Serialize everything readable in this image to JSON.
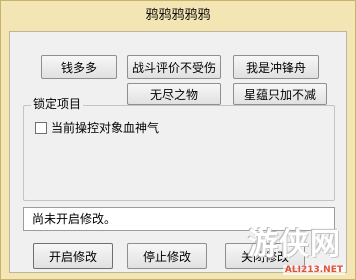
{
  "window": {
    "title": "鸦鸦鸦鸦鸦"
  },
  "buttons": {
    "money": "钱多多",
    "battle": "战斗评价不受伤",
    "charge": "我是冲锋舟",
    "endless": "无尽之物",
    "bomb": "星蕴只加不减"
  },
  "lock_group": {
    "label": "锁定项目",
    "option_label": "当前操控对象血神气",
    "option_checked": false
  },
  "status": {
    "text": "尚未开启修改。"
  },
  "footer": {
    "start_label": "开启修改",
    "stop_label": "停止修改",
    "close_label": "关闭修改"
  },
  "watermark": {
    "logo_text": "游侠网",
    "url": "ALI213.NET"
  }
}
